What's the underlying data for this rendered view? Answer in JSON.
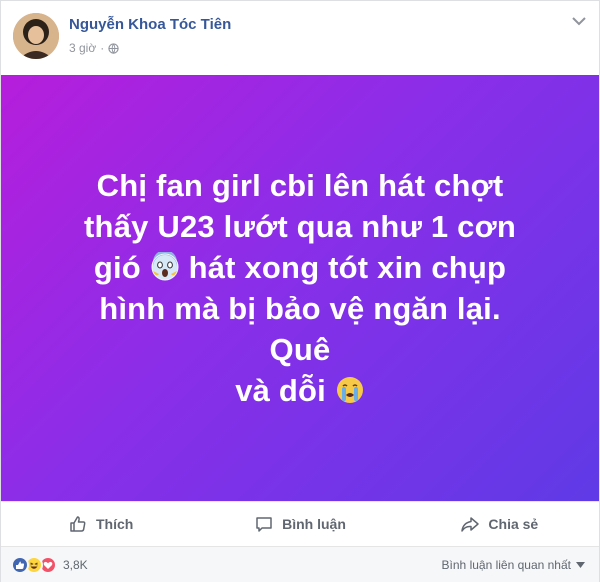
{
  "header": {
    "author": "Nguyễn Khoa Tóc Tiên",
    "time": "3 giờ",
    "privacy_icon": "globe-icon",
    "menu_icon": "chevron-down-icon"
  },
  "post": {
    "line1": "Chị fan girl cbi lên hát chợt",
    "line2": "thấy U23 lướt qua như 1 cơn",
    "line3a": "gió",
    "line3b": "hát xong tót xin chụp",
    "line4": "hình mà bị bảo vệ ngăn lại. Quê",
    "line5": "và dỗi",
    "emoji1": "scream-emoji",
    "emoji2": "crying-emoji",
    "gradient_colors": [
      "#b61edb",
      "#8a2ee9",
      "#5f3ae6"
    ]
  },
  "actions": {
    "like": "Thích",
    "comment": "Bình luận",
    "share": "Chia sẻ"
  },
  "footer": {
    "reaction_count": "3,8K",
    "sort_label": "Bình luận liên quan nhất",
    "reactions": [
      "like-reaction",
      "haha-reaction",
      "love-reaction"
    ]
  },
  "colors": {
    "author": "#365899",
    "like_blue": "#4267b2",
    "love_red": "#f25268",
    "haha_yellow": "#fcd53f"
  }
}
